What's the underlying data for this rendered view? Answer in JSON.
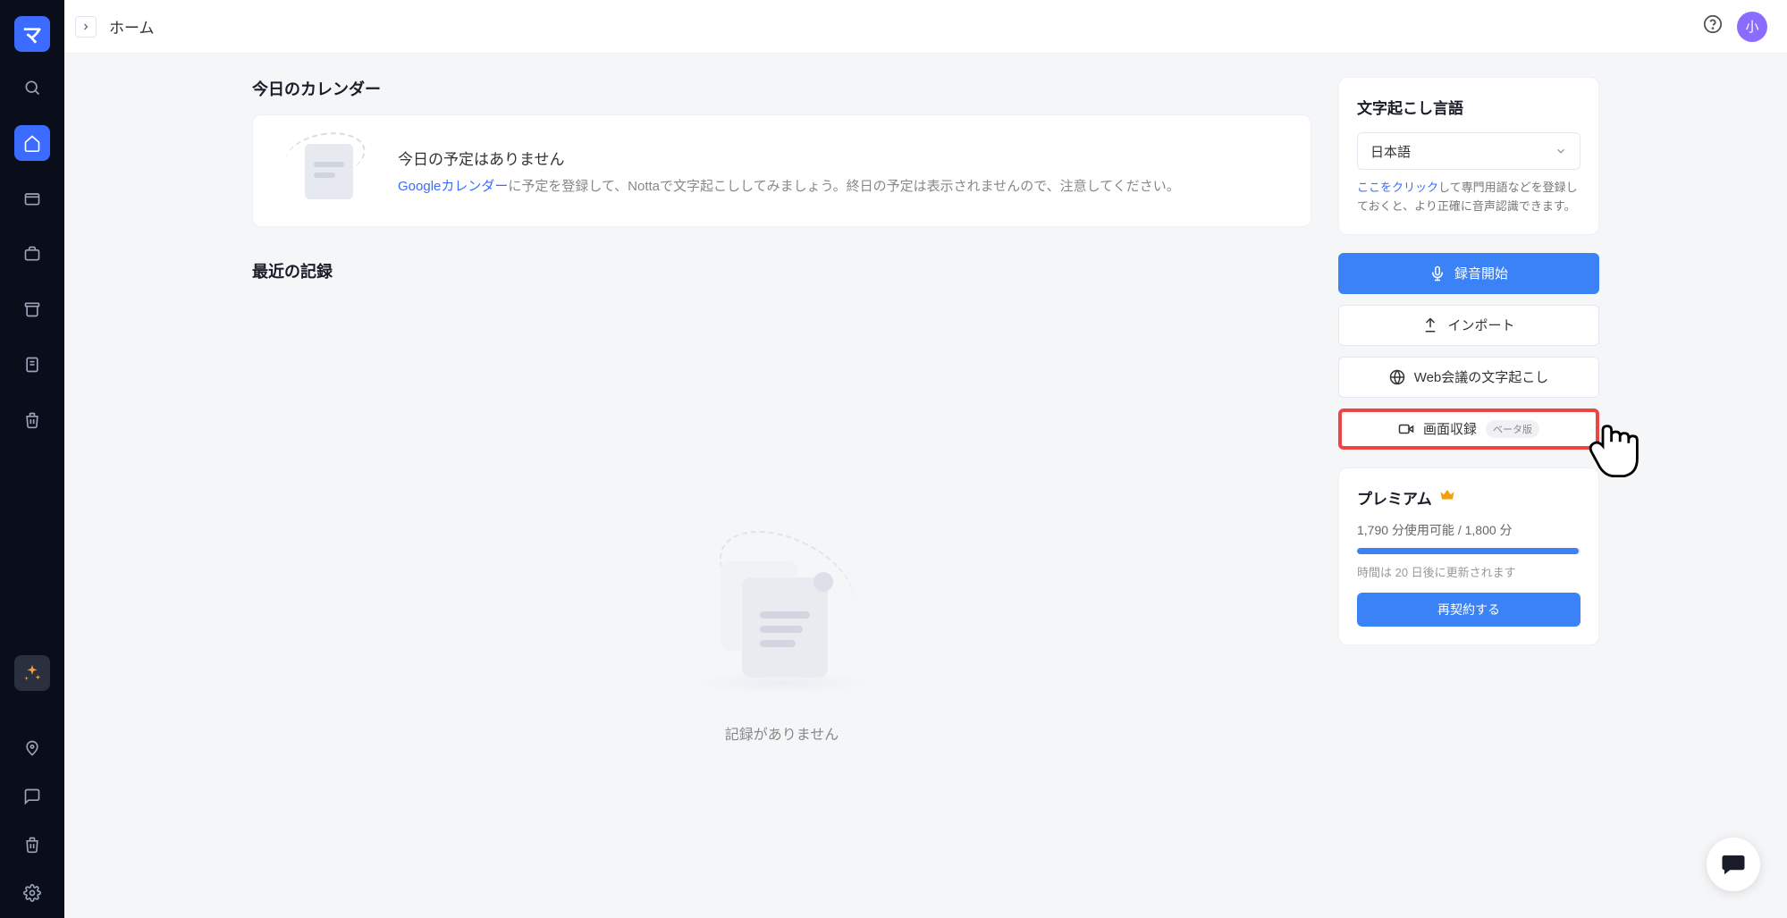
{
  "header": {
    "breadcrumb": "ホーム",
    "avatar_text": "小"
  },
  "calendar": {
    "section_title": "今日のカレンダー",
    "no_events": "今日の予定はありません",
    "link_text": "Googleカレンダー",
    "desc_rest": "に予定を登録して、Nottaで文字起こししてみましょう。終日の予定は表示されませんので、注意してください。"
  },
  "recent": {
    "section_title": "最近の記録",
    "empty_text": "記録がありません"
  },
  "language_card": {
    "title": "文字起こし言語",
    "selected": "日本語",
    "hint_link": "ここをクリック",
    "hint_rest": "して専門用語などを登録しておくと、より正確に音声認識できます。"
  },
  "actions": {
    "record": "録音開始",
    "import": "インポート",
    "web_meeting": "Web会議の文字起こし",
    "screen_record": "画面収録",
    "beta": "ベータ版"
  },
  "premium": {
    "title": "プレミアム",
    "usage_used": "1,790",
    "usage_unit1": "分使用可能",
    "usage_sep": " / ",
    "usage_total": "1,800",
    "usage_unit2": "分",
    "progress_pct": 99,
    "renew_text": "時間は 20 日後に更新されます",
    "renew_btn": "再契約する"
  }
}
